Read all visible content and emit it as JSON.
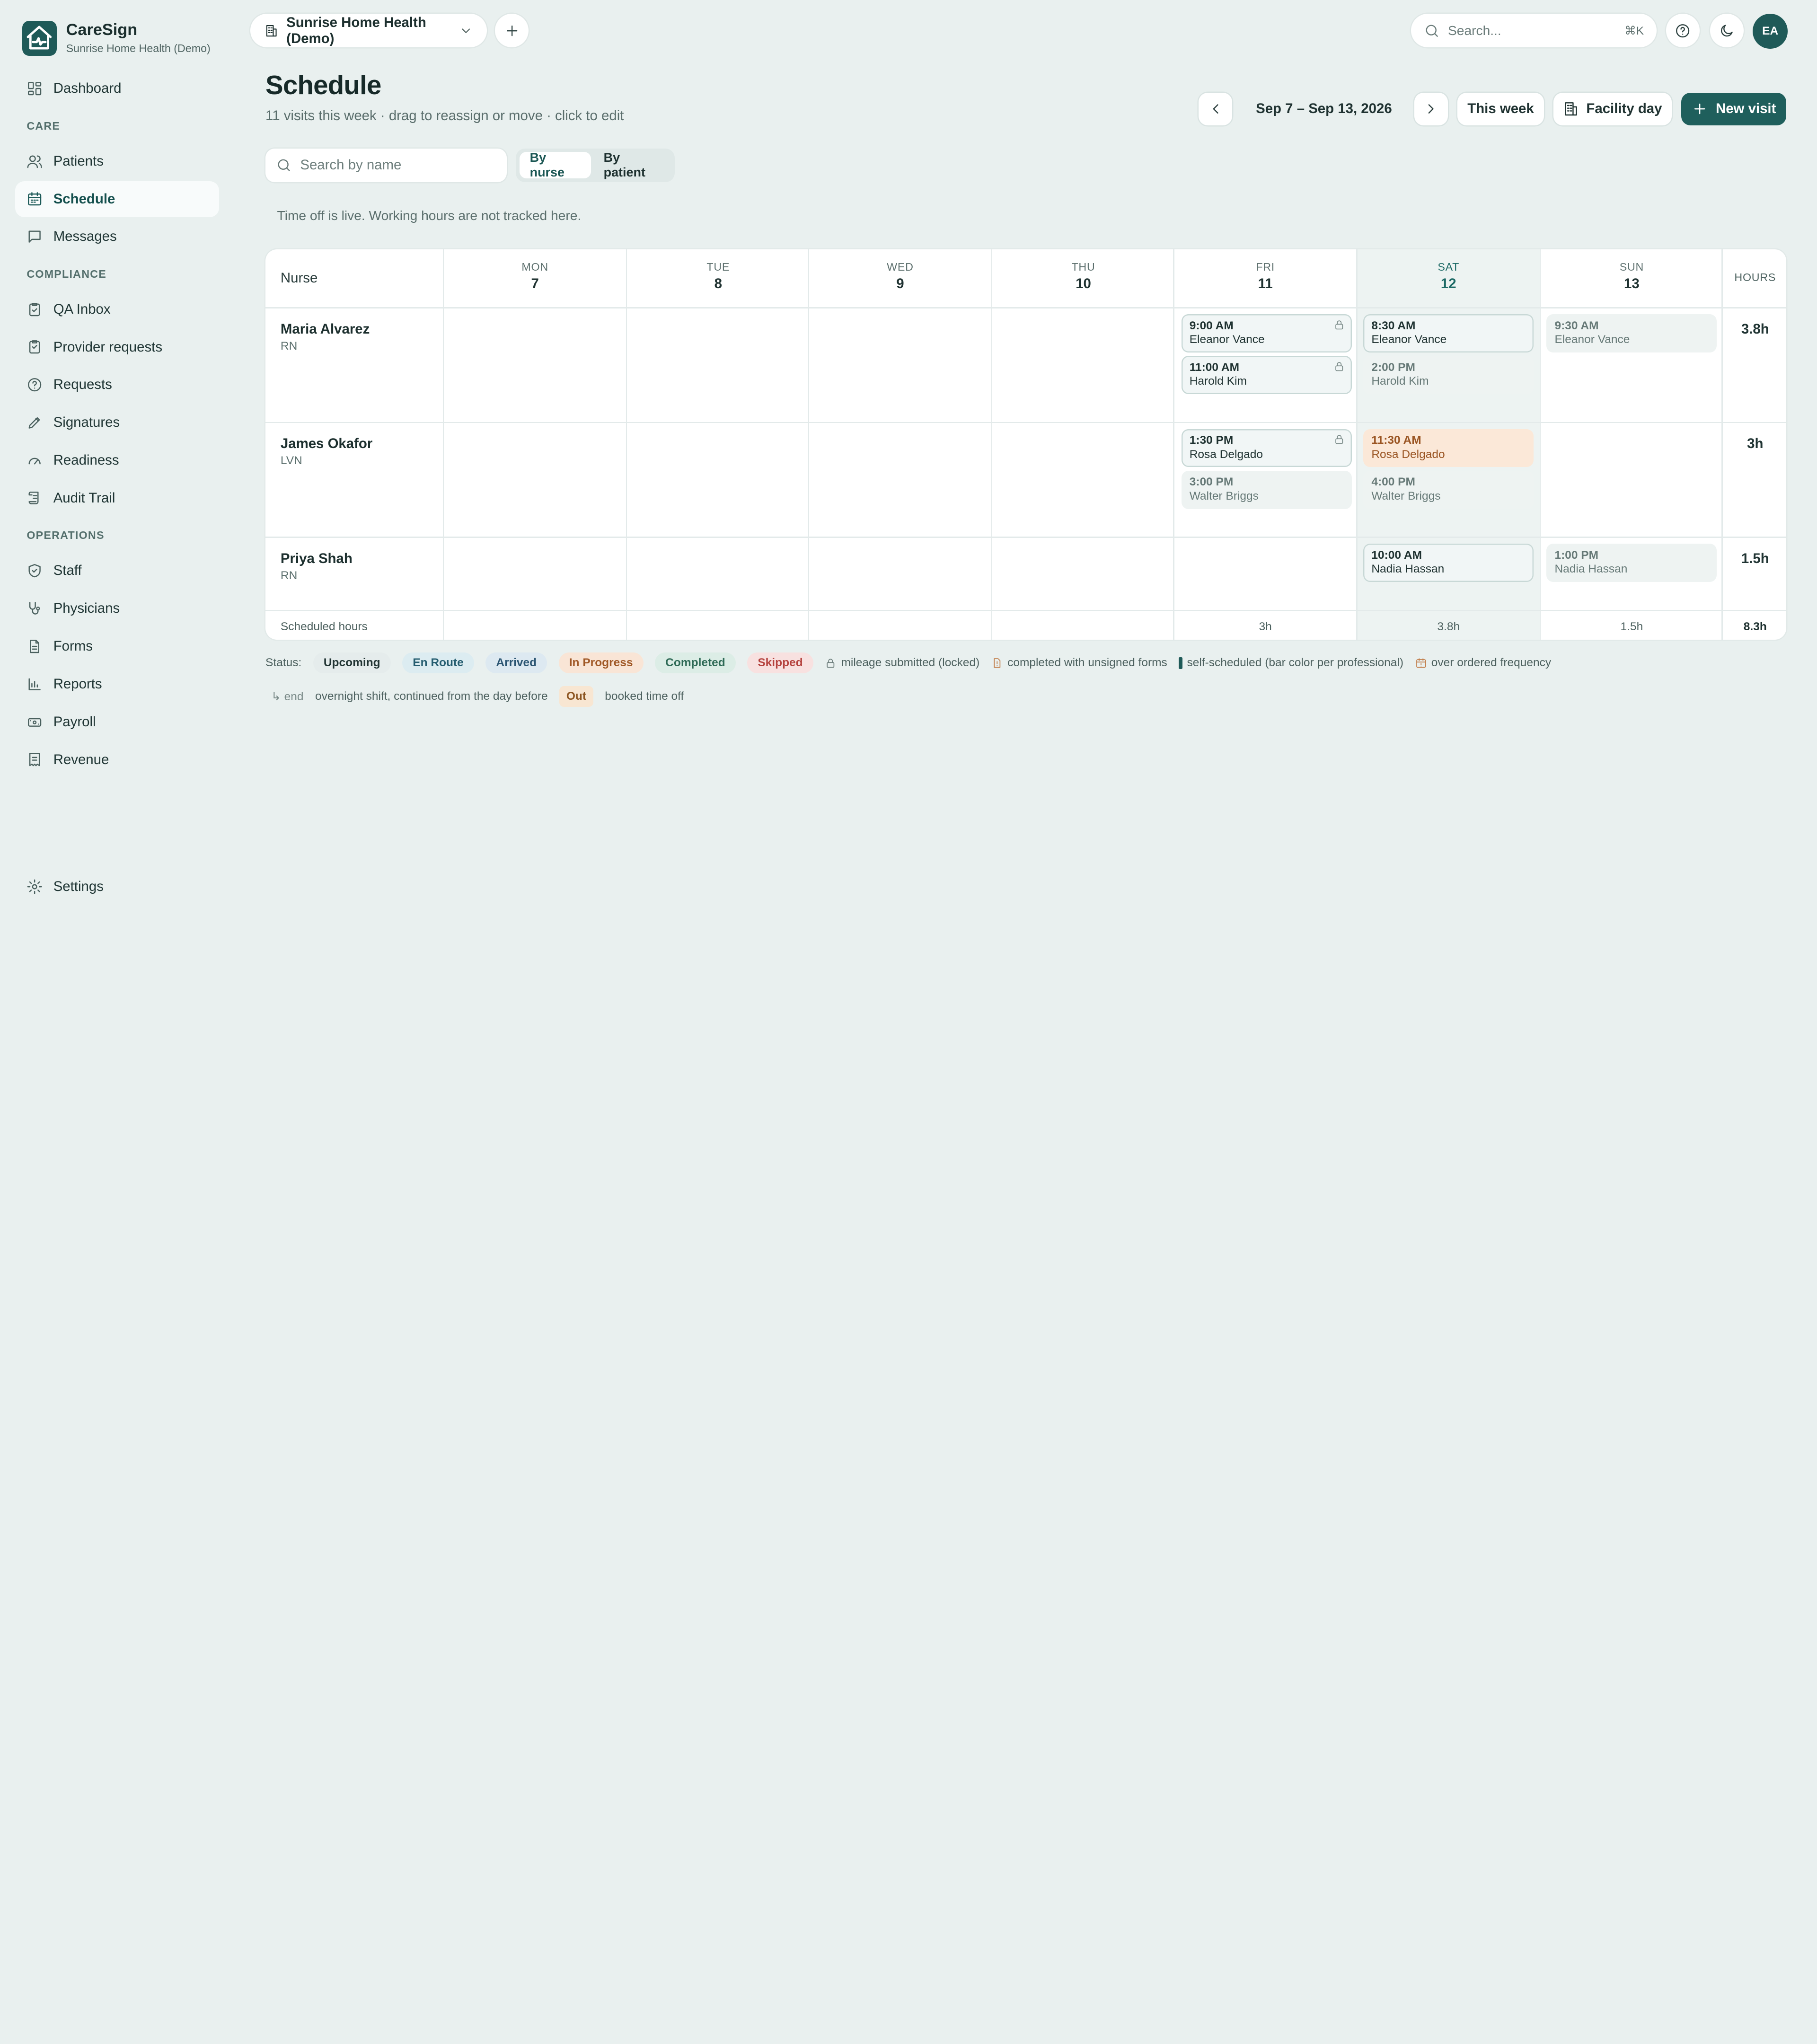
{
  "brand": {
    "name": "CareSign",
    "org": "Sunrise Home Health (Demo)"
  },
  "sidebar": {
    "dashboard": "Dashboard",
    "sections": {
      "care": "CARE",
      "compliance": "COMPLIANCE",
      "operations": "OPERATIONS"
    },
    "care_items": [
      "Patients",
      "Schedule",
      "Messages"
    ],
    "compliance_items": [
      "QA Inbox",
      "Provider requests",
      "Requests",
      "Signatures",
      "Readiness",
      "Audit Trail"
    ],
    "operations_items": [
      "Staff",
      "Physicians",
      "Forms",
      "Reports",
      "Payroll",
      "Revenue"
    ],
    "settings": "Settings",
    "active": "Schedule"
  },
  "topbar": {
    "org_switcher": "Sunrise Home Health (Demo)",
    "search_placeholder": "Search...",
    "search_shortcut": "⌘K",
    "avatar_initials": "EA"
  },
  "header": {
    "title": "Schedule",
    "subtitle": "11 visits this week · drag to reassign or move · click to edit",
    "date_range": "Sep 7 – Sep 13, 2026",
    "this_week": "This week",
    "facility_day": "Facility day",
    "new_visit": "New visit"
  },
  "filters": {
    "search_placeholder": "Search by name",
    "view_by_nurse": "By nurse",
    "view_by_patient": "By patient",
    "active_view": "By nurse"
  },
  "notice": "Time off is live. Working hours are not tracked here.",
  "grid": {
    "nurse_header": "Nurse",
    "hours_header": "HOURS",
    "days": [
      {
        "dow": "MON",
        "num": "7"
      },
      {
        "dow": "TUE",
        "num": "8"
      },
      {
        "dow": "WED",
        "num": "9"
      },
      {
        "dow": "THU",
        "num": "10"
      },
      {
        "dow": "FRI",
        "num": "11"
      },
      {
        "dow": "SAT",
        "num": "12"
      },
      {
        "dow": "SUN",
        "num": "13"
      }
    ],
    "today_index": 5,
    "nurses": [
      {
        "name": "Maria Alvarez",
        "role": "RN",
        "hours": "3.8h",
        "visits": [
          {
            "time": "9:00 AM",
            "patient": "Eleanor Vance"
          },
          {
            "time": "11:00 AM",
            "patient": "Harold Kim"
          },
          {
            "time": "8:30 AM",
            "patient": "Eleanor Vance"
          },
          {
            "time": "2:00 PM",
            "patient": "Harold Kim"
          },
          {
            "time": "9:30 AM",
            "patient": "Eleanor Vance"
          }
        ]
      },
      {
        "name": "James Okafor",
        "role": "LVN",
        "hours": "3h",
        "visits": [
          {
            "time": "1:30 PM",
            "patient": "Rosa Delgado"
          },
          {
            "time": "3:00 PM",
            "patient": "Walter Briggs"
          },
          {
            "time": "11:30 AM",
            "patient": "Rosa Delgado"
          },
          {
            "time": "4:00 PM",
            "patient": "Walter Briggs"
          }
        ]
      },
      {
        "name": "Priya Shah",
        "role": "RN",
        "hours": "1.5h",
        "visits": [
          {
            "time": "10:00 AM",
            "patient": "Nadia Hassan"
          },
          {
            "time": "1:00 PM",
            "patient": "Nadia Hassan"
          }
        ]
      }
    ],
    "footer": {
      "label": "Scheduled hours",
      "fri": "3h",
      "sat": "3.8h",
      "sun": "1.5h",
      "total": "8.3h"
    }
  },
  "legend": {
    "status_label": "Status:",
    "statuses": [
      "Upcoming",
      "En Route",
      "Arrived",
      "In Progress",
      "Completed",
      "Skipped"
    ],
    "locked": "mileage submitted (locked)",
    "unsigned": "completed with unsigned forms",
    "self_scheduled": "self-scheduled (bar color per professional)",
    "over_frequency": "over ordered frequency",
    "overnight_tag": "↳ end",
    "overnight": "overnight shift, continued from the day before",
    "out_tag": "Out",
    "out": "booked time off"
  },
  "colors": {
    "brand": "#1f5a58",
    "primary_button": "#1f5f5c",
    "in_progress": "#fbe8d8",
    "today_column": "#edf3f2",
    "background": "#e9f0ef"
  }
}
